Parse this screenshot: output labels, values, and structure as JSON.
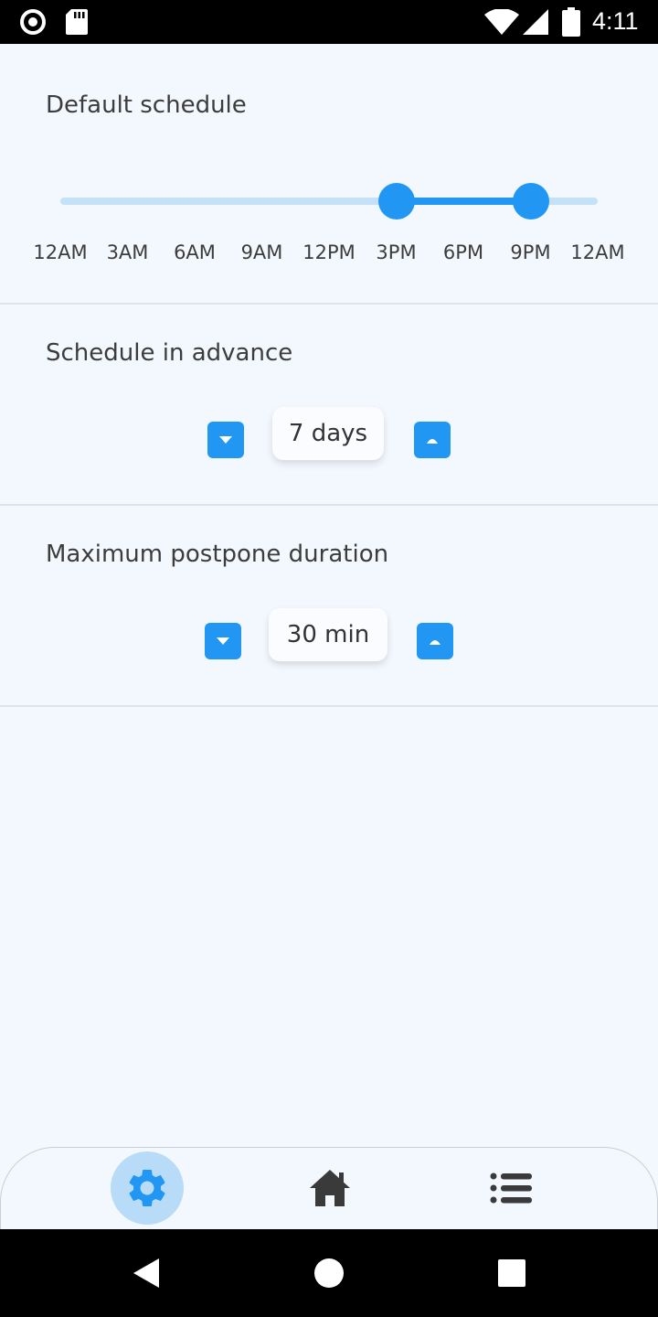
{
  "status_bar": {
    "time": "4:11",
    "icons": [
      "record-icon",
      "sd-card-icon",
      "wifi-icon",
      "signal-icon",
      "battery-icon"
    ]
  },
  "default_schedule": {
    "title": "Default schedule",
    "range_start": "3PM",
    "range_end": "9PM",
    "range_start_hour": 15,
    "range_end_hour": 21,
    "ticks": [
      "12AM",
      "3AM",
      "6AM",
      "9AM",
      "12PM",
      "3PM",
      "6PM",
      "9PM",
      "12AM"
    ]
  },
  "schedule_in_advance": {
    "title": "Schedule in advance",
    "value": "7 days"
  },
  "max_postpone": {
    "title": "Maximum postpone duration",
    "value": "30 min"
  },
  "bottom_nav": {
    "items": [
      {
        "name": "settings",
        "icon": "gear-icon",
        "active": true
      },
      {
        "name": "home",
        "icon": "home-icon",
        "active": false
      },
      {
        "name": "list",
        "icon": "list-icon",
        "active": false
      }
    ]
  },
  "colors": {
    "accent": "#2196f3",
    "track_light": "#c5e1f7",
    "background": "#f3f8fe",
    "active_nav_bg": "#b8dcf7"
  }
}
